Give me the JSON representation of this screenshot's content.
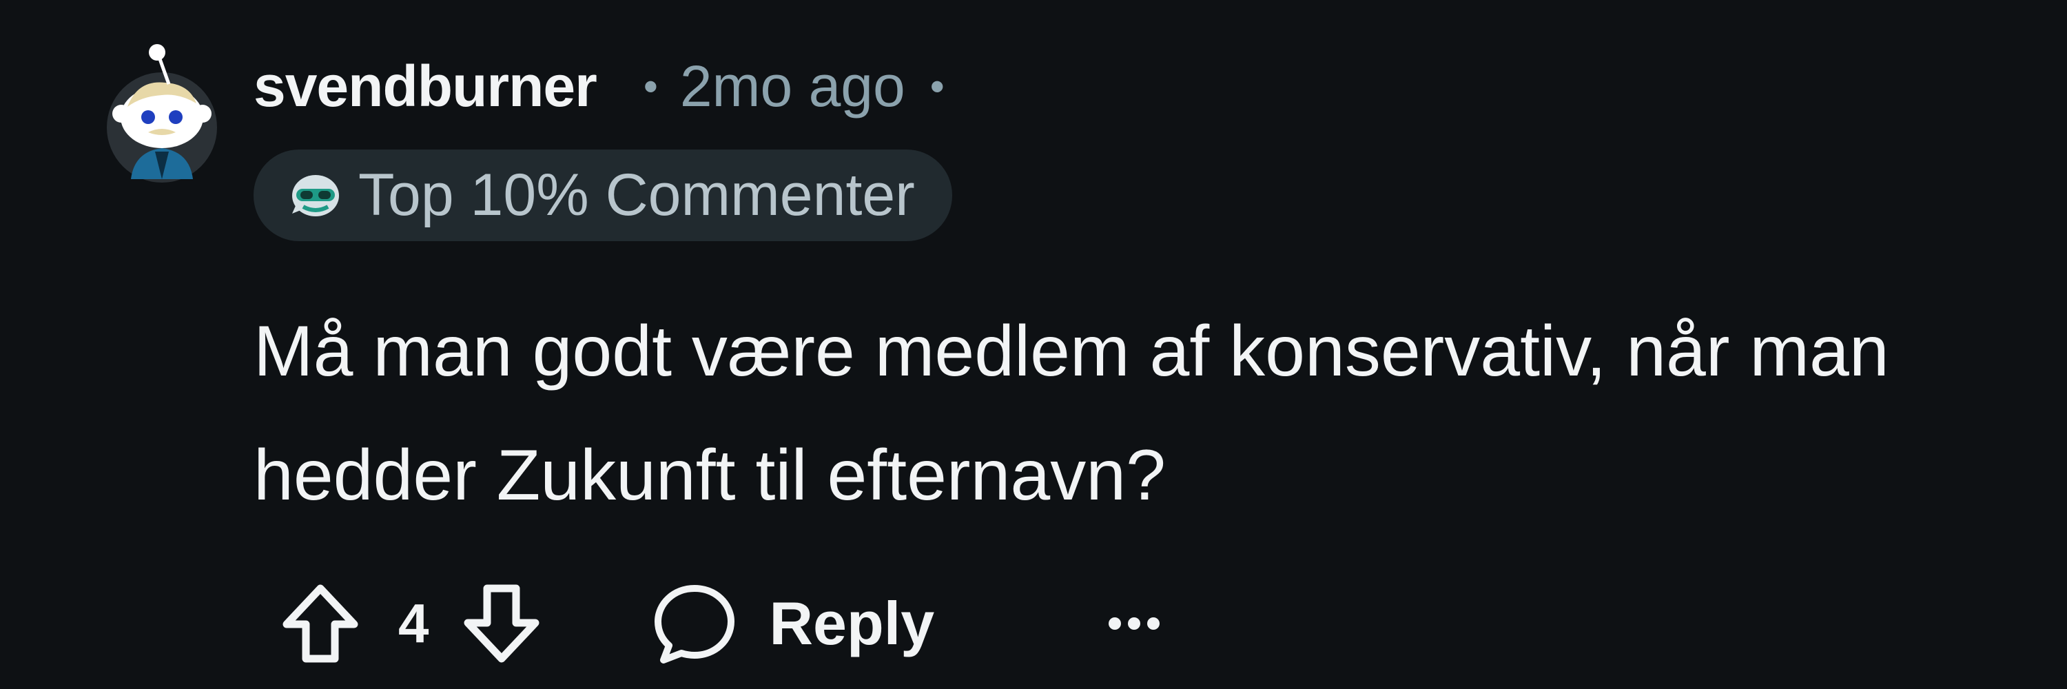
{
  "comment": {
    "author": "svendburner",
    "separator": "•",
    "age": "2mo ago",
    "badge": {
      "label": "Top 10% Commenter",
      "icon": "commenter-badge-icon"
    },
    "body": "Må man godt være medlem af konservativ, når man hedder Zukunft til efternavn?",
    "score": "4",
    "reply_label": "Reply",
    "icons": {
      "avatar": "snoo-avatar",
      "upvote": "upvote-arrow-icon",
      "downvote": "downvote-arrow-icon",
      "reply": "speech-bubble-icon",
      "more": "more-options-icon"
    }
  },
  "colors": {
    "background": "#0e1114",
    "text_primary": "#f2f4f5",
    "text_muted": "#8ba2ad",
    "badge_bg": "#212a2f"
  }
}
